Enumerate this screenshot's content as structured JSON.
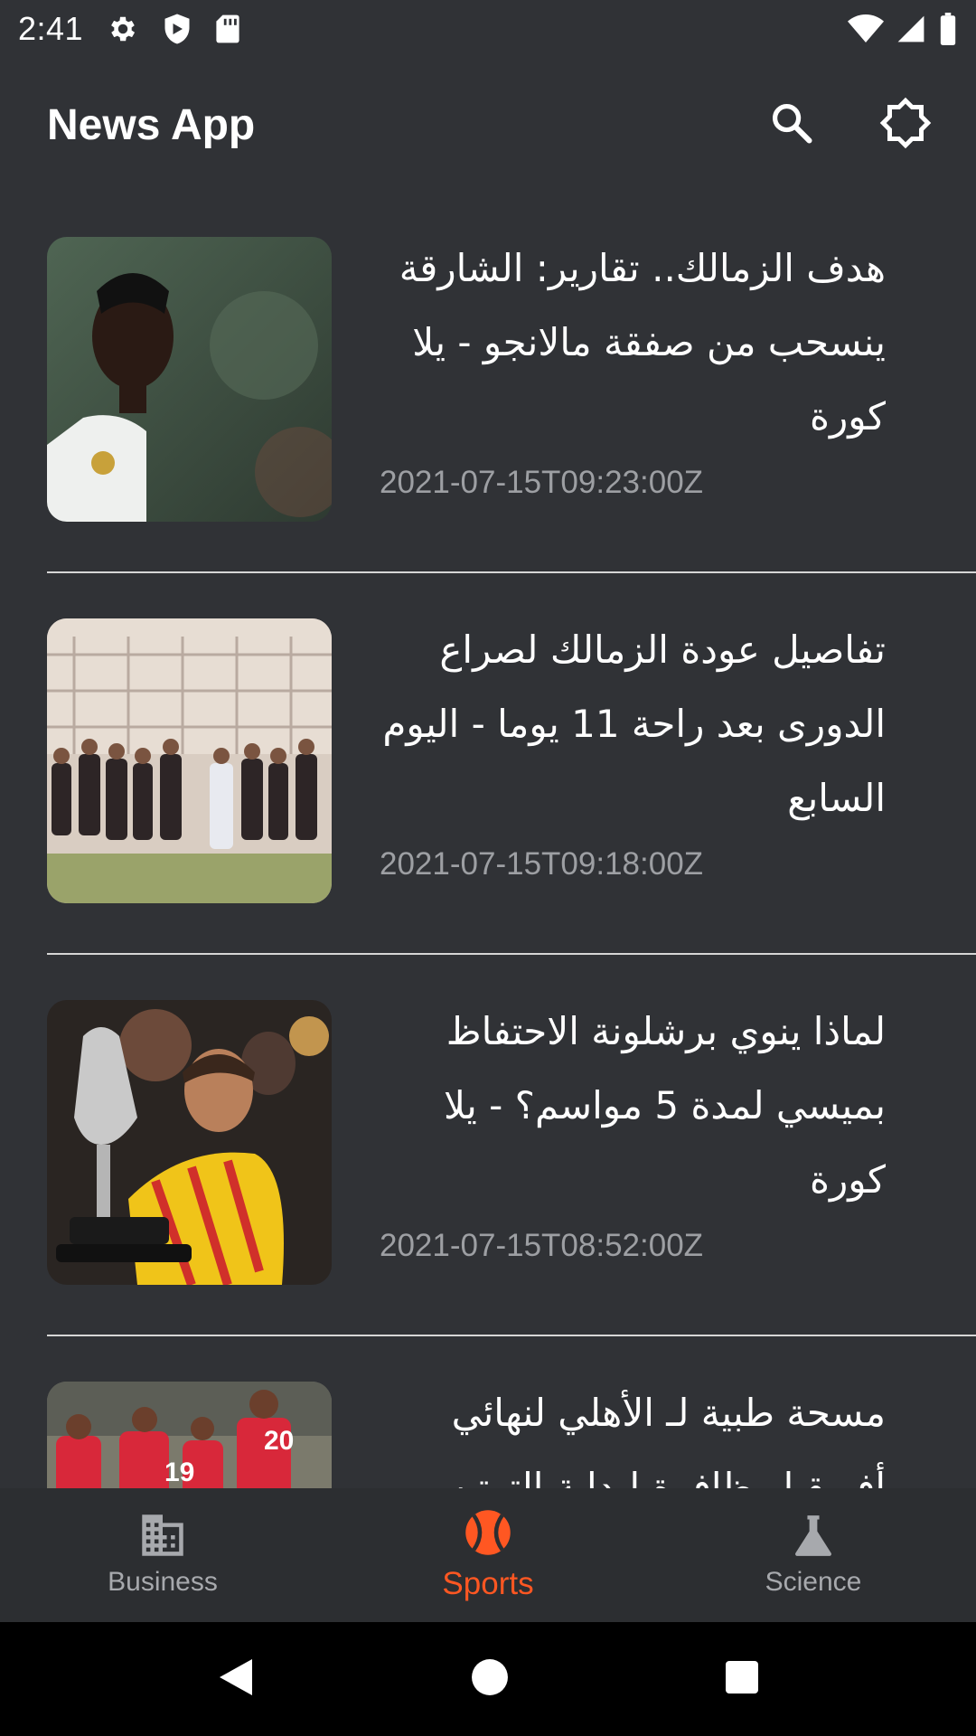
{
  "status_bar": {
    "time": "2:41"
  },
  "app_bar": {
    "title": "News App"
  },
  "articles": [
    {
      "headline": "هدف الزمالك.. تقارير: الشارقة ينسحب من صفقة مالانجو - يلا كورة",
      "date": "2021-07-15T09:23:00Z"
    },
    {
      "headline": "تفاصيل عودة الزمالك لصراع الدورى بعد راحة 11 يوما - اليوم السابع",
      "date": "2021-07-15T09:18:00Z"
    },
    {
      "headline": "لماذا ينوي برشلونة الاحتفاظ بميسي لمدة 5 مواسم؟ - يلا كورة",
      "date": "2021-07-15T08:52:00Z"
    },
    {
      "headline": "مسحة طبية لـ الأهلي لنهائي أفريقيا وظافرة لبداية الترتيب",
      "date": ""
    }
  ],
  "bottom_nav": {
    "items": [
      {
        "label": "Business",
        "icon": "business-icon"
      },
      {
        "label": "Sports",
        "icon": "sports-icon"
      },
      {
        "label": "Science",
        "icon": "science-icon"
      }
    ],
    "active_index": 1,
    "active_color": "#ff5722",
    "inactive_color": "#a7a9ad"
  },
  "colors": {
    "background": "#303236",
    "date": "#9d9fa3"
  }
}
